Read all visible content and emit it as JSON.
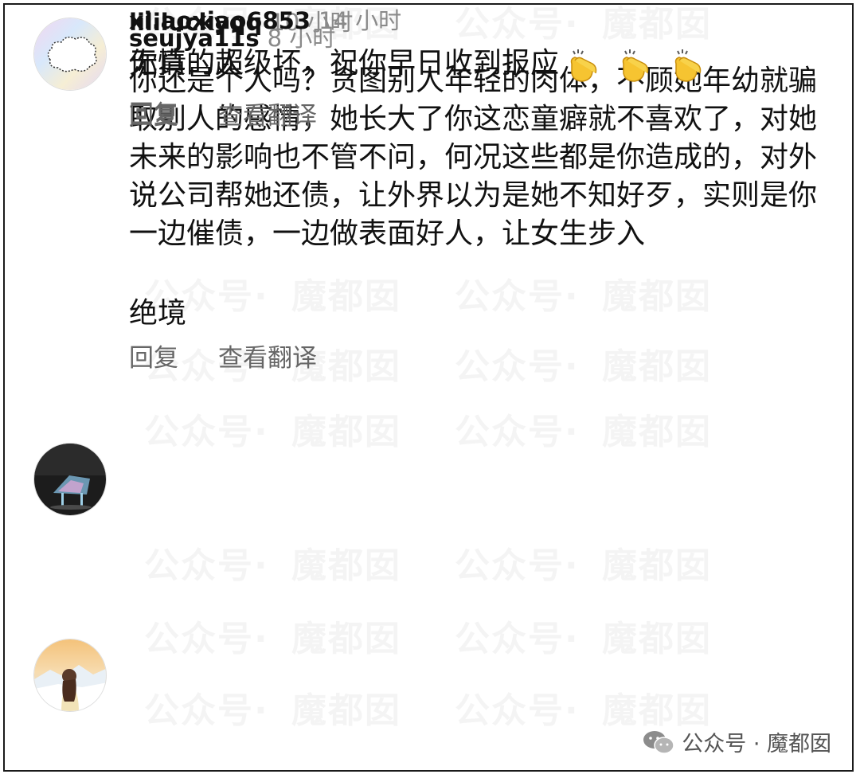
{
  "watermark": {
    "text_left": "公众号·",
    "text_right": "魔都囡"
  },
  "comments": [
    {
      "username": "seujya11s",
      "time": "8 小时",
      "text": "你还是个人吗？贪图别人年轻的肉体，不顾她年幼就骗取别人的感情，她长大了你这恋童癖就不喜欢了，对她未来的影响也不管不问，何况这些都是你造成的，对外说公司帮她还债，让外界以为是她不知好歹，实则是你一边催债，一边做表面好人，让女生步入",
      "text_extra": "绝境",
      "reply_label": "回复",
      "translate_label": "查看翻译"
    },
    {
      "username": "lililuckyqq",
      "time": "10 小时",
      "text": "你真的超级坏，祝你早日收到报应",
      "emoji": "clapping-hands-icon",
      "reply_label": "回复",
      "translate_label": "查看翻译"
    },
    {
      "username": "xi.aoxiao6853",
      "time": "14 小时",
      "text": "无情的人",
      "reply_label": "回复"
    }
  ],
  "footer": {
    "text": "公众号 · 魔都囡"
  }
}
